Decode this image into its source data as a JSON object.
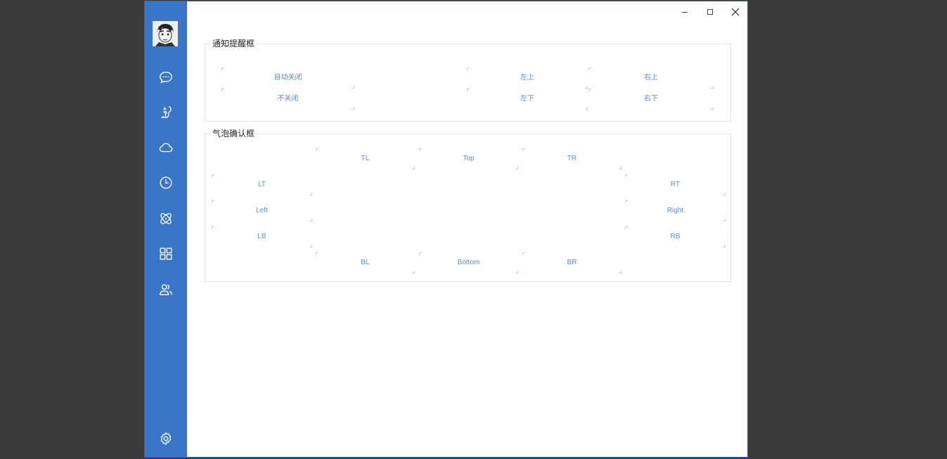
{
  "colors": {
    "sidebar": "#3a76c8",
    "window_border": "#2f66c3",
    "accent_text": "#4f7fc8",
    "backdrop": "#3a3a3a"
  },
  "window_controls": [
    {
      "name": "minimize-button",
      "icon": "minimize-icon"
    },
    {
      "name": "maximize-button",
      "icon": "maximize-icon"
    },
    {
      "name": "close-button",
      "icon": "close-icon"
    }
  ],
  "sidebar": {
    "avatar": "avatar",
    "nav": [
      {
        "name": "chat",
        "icon": "chat-bubble-icon"
      },
      {
        "name": "squirrel",
        "icon": "squirrel-icon"
      },
      {
        "name": "cloud",
        "icon": "cloud-icon"
      },
      {
        "name": "history",
        "icon": "clock-icon"
      },
      {
        "name": "atom",
        "icon": "atom-icon"
      },
      {
        "name": "apps",
        "icon": "grid-icon"
      },
      {
        "name": "contacts",
        "icon": "users-icon"
      }
    ],
    "settings_icon": "gear-icon"
  },
  "notification": {
    "title": "通知提醒框",
    "buttons": [
      "自动关闭",
      "不关闭",
      "左上",
      "左下",
      "右上",
      "右下"
    ]
  },
  "bubble": {
    "title": "气泡确认框",
    "top": [
      "TL",
      "Top",
      "TR"
    ],
    "left": [
      "LT",
      "Left",
      "LB"
    ],
    "right": [
      "RT",
      "Right",
      "RB"
    ],
    "bottom": [
      "BL",
      "Bottom",
      "BR"
    ]
  }
}
